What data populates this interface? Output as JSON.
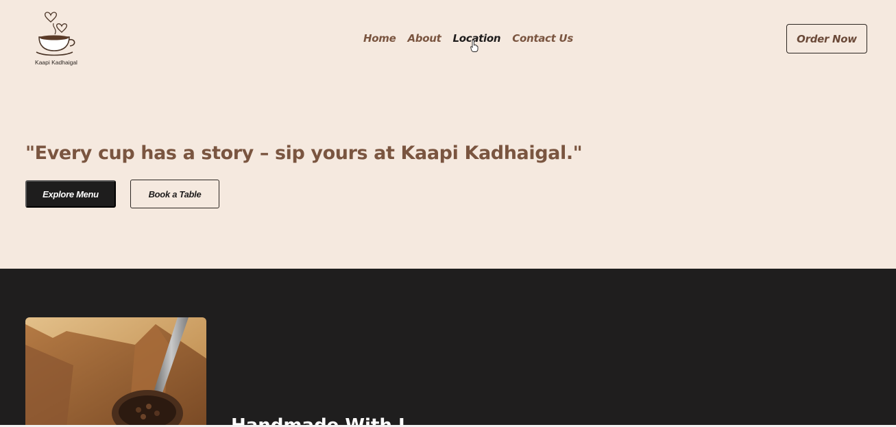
{
  "brand": {
    "name": "Kaapi Kadhaigal",
    "icon": "coffee-cup-hearts-logo"
  },
  "nav": {
    "items": [
      {
        "label": "Home"
      },
      {
        "label": "About"
      },
      {
        "label": "Location"
      },
      {
        "label": "Contact Us"
      }
    ],
    "active": "Location"
  },
  "header": {
    "order_label": "Order Now"
  },
  "hero": {
    "quote": "\"Every cup has a story – sip yours at Kaapi Kadhaigal.\"",
    "primary_button": "Explore Menu",
    "secondary_button": "Book a Table"
  },
  "section": {
    "heading_partial": "Handmade With L",
    "image": "coffee-beans-scoop-photo"
  },
  "colors": {
    "background": "#f5e9df",
    "accent_brown": "#7a5540",
    "dark": "#1f1e1e",
    "text_dark": "#1e1c1c"
  }
}
